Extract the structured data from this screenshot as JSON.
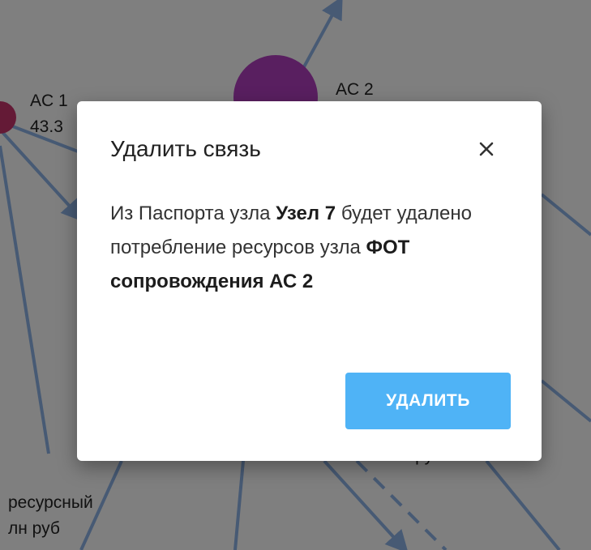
{
  "graph": {
    "colors": {
      "edge": "#8fb4e8",
      "node_ac1": "#c9356d",
      "node_ac2": "#b23fc0"
    },
    "labels": {
      "ac1_name": "AC 1",
      "ac1_value": "43.3",
      "ac2_name": "AC 2",
      "resource_line1": "ресурсный",
      "resource_line2": "лн руб",
      "partial_bottom": "млн руб"
    }
  },
  "dialog": {
    "title": "Удалить связь",
    "close_icon": "close-icon",
    "body": {
      "part1": "Из Паспорта узла ",
      "node_name": "Узел 7",
      "part2": " будет удалено потребление ресурсов узла ",
      "resource_name": "ФОТ сопровождения АС 2"
    },
    "delete_label": "УДАЛИТЬ",
    "accent_color": "#4fb3f6"
  }
}
